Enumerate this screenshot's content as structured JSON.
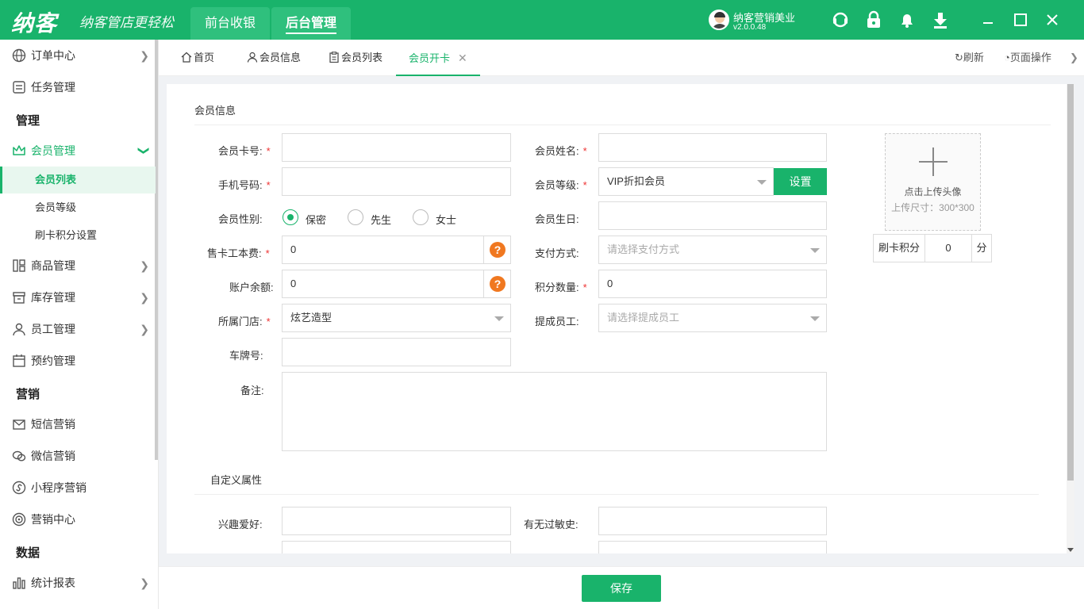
{
  "header": {
    "logo": "纳客",
    "slogan": "纳客管店更轻松",
    "nav": [
      "前台收银",
      "后台管理"
    ],
    "user_name": "纳客营销美业",
    "version": "v2.0.0.48"
  },
  "sidebar": {
    "items": [
      {
        "label": "订单中心"
      },
      {
        "label": "任务管理"
      },
      {
        "section": "管理"
      },
      {
        "label": "会员管理"
      },
      {
        "sub": "会员列表"
      },
      {
        "sub": "会员等级"
      },
      {
        "sub": "刷卡积分设置"
      },
      {
        "label": "商品管理"
      },
      {
        "label": "库存管理"
      },
      {
        "label": "员工管理"
      },
      {
        "label": "预约管理"
      },
      {
        "section": "营销"
      },
      {
        "label": "短信营销"
      },
      {
        "label": "微信营销"
      },
      {
        "label": "小程序营销"
      },
      {
        "label": "营销中心"
      },
      {
        "section": "数据"
      },
      {
        "label": "统计报表"
      }
    ]
  },
  "tabs": {
    "items": [
      "首页",
      "会员信息",
      "会员列表",
      "会员开卡"
    ],
    "refresh": "刷新",
    "page_ops": "页面操作"
  },
  "form": {
    "section_title": "会员信息",
    "card_no_label": "会员卡号:",
    "name_label": "会员姓名:",
    "phone_label": "手机号码:",
    "level_label": "会员等级:",
    "level_value": "VIP折扣会员",
    "set_button": "设置",
    "gender_label": "会员性别:",
    "gender_options": [
      "保密",
      "先生",
      "女士"
    ],
    "birthday_label": "会员生日:",
    "fee_label": "售卡工本费:",
    "fee_value": "0",
    "pay_label": "支付方式:",
    "pay_placeholder": "请选择支付方式",
    "balance_label": "账户余额:",
    "balance_value": "0",
    "points_label": "积分数量:",
    "points_value": "0",
    "store_label": "所属门店:",
    "store_value": "炫艺造型",
    "staff_label": "提成员工:",
    "staff_placeholder": "请选择提成员工",
    "plate_label": "车牌号:",
    "remark_label": "备注:",
    "custom_title": "自定义属性",
    "hobby_label": "兴趣爱好:",
    "allergy_label": "有无过敏史:",
    "upload_text": "点击上传头像",
    "upload_size": "上传尺寸：300*300",
    "swipe_label": "刷卡积分",
    "swipe_value": "0",
    "swipe_unit": "分"
  },
  "footer": {
    "save": "保存"
  }
}
